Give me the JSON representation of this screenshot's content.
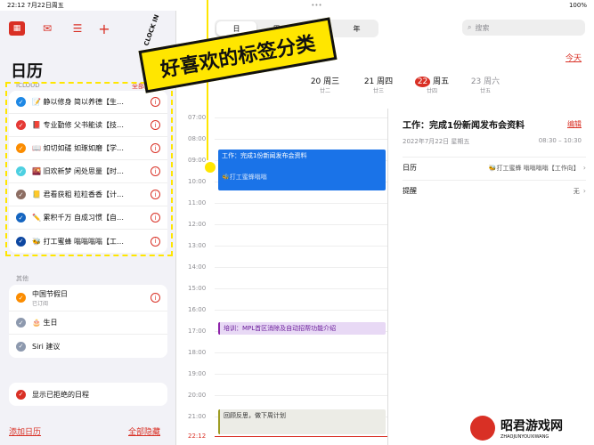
{
  "status": {
    "time": "22:12",
    "date": "7月22日周五",
    "dots": "•••",
    "battery": "100%"
  },
  "sidebar": {
    "title": "日历",
    "icloud_label": "ICLOUD",
    "all_hidden_label": "全部隐藏",
    "icloud_items": [
      {
        "label": "📝 静以修身 简以养德【生…",
        "color": "#1e88e5"
      },
      {
        "label": "📕 专业勤修 父书能读【技…",
        "color": "#e53935"
      },
      {
        "label": "📖 如切如磋 如琢如磨【学…",
        "color": "#fb8c00"
      },
      {
        "label": "🌇 旧欢新梦 闲处思量【时…",
        "color": "#4dd0e1"
      },
      {
        "label": "📒 君看获粗 粒粒香香【计…",
        "color": "#8d6e63"
      },
      {
        "label": "✏️ 累积千万 自成习惯【自…",
        "color": "#1565c0"
      },
      {
        "label": "🐝 打工蜜蜂 嗡嗡嗡嗡【工…",
        "color": "#0d47a1"
      }
    ],
    "other_label": "其他",
    "other_items": [
      {
        "label": "中国节假日",
        "sub": "已订阅",
        "color": "#fb8c00"
      },
      {
        "label": "🎂 生日",
        "sub": "",
        "color": "#8d99ae"
      },
      {
        "label": "Siri 建议",
        "sub": "",
        "color": "#8d99ae"
      }
    ],
    "declined_label": "显示已拒绝的日程",
    "add_calendar": "添加日历",
    "hide_all": "全部隐藏"
  },
  "toolbar": {
    "tabs": [
      "日",
      "周",
      "月",
      "年"
    ],
    "active_tab": "日",
    "search_placeholder": "搜索",
    "today": "今天"
  },
  "days": [
    {
      "label": "",
      "num": "",
      "lunar": ""
    },
    {
      "label": "周三",
      "num": "20",
      "lunar": "廿二"
    },
    {
      "label": "周四",
      "num": "21",
      "lunar": "廿三"
    },
    {
      "label": "周五",
      "num": "22",
      "lunar": "廿四"
    },
    {
      "label": "周六",
      "num": "23",
      "lunar": "廿五"
    }
  ],
  "times": [
    "07:00",
    "08:00",
    "09:00",
    "10:00",
    "11:00",
    "12:00",
    "13:00",
    "14:00",
    "15:00",
    "16:00",
    "17:00",
    "18:00",
    "19:00",
    "20:00",
    "21:00",
    "22:12"
  ],
  "events": [
    {
      "title": "工作：完成1份新闻发布会资料",
      "sub": "🐝打工蜜蜂嗡嗡"
    },
    {
      "title": "培训：MPL首区消除及自动招帮功能介绍"
    },
    {
      "title": "回顾反思，做下周计划"
    }
  ],
  "detail": {
    "title": "工作：完成1份新闻发布会资料",
    "edit": "编辑",
    "date": "2022年7月22日 星期五",
    "time": "08:30 – 10:30",
    "calendar_label": "日历",
    "calendar_value": "🐝打工蜜蜂 嗡嗡嗡嗡【工作向】",
    "reminder_label": "提醒",
    "reminder_value": "无"
  },
  "banner": "好喜欢的标签分类",
  "clock_label": "CLOCK IN",
  "watermark": {
    "title": "昭君游戏网",
    "sub": "ZHAOJUNYOUXIWANG"
  },
  "colors": {
    "accent": "#d93025",
    "highlight": "#ffe600",
    "event_blue": "#1a73e8",
    "event_purple": "#e8d9f5",
    "event_grey": "#ecece6"
  }
}
